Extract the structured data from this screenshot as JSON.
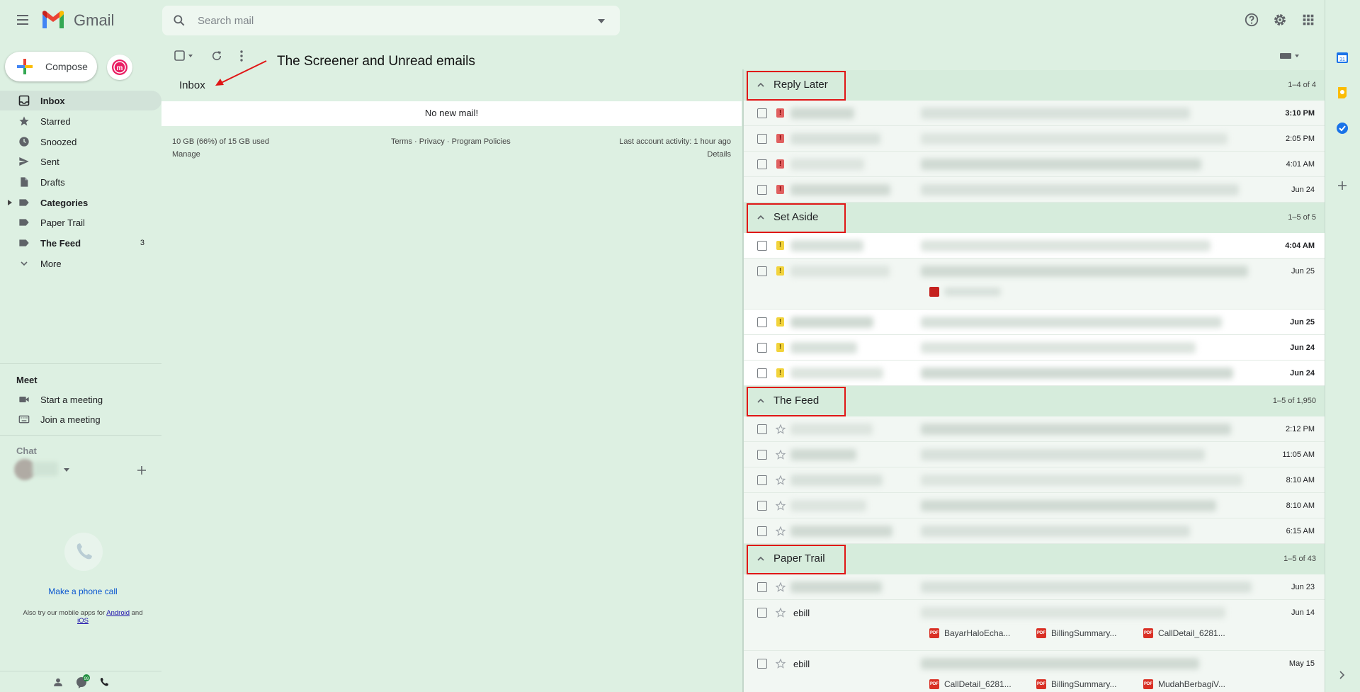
{
  "header": {
    "brand": "Gmail",
    "search_placeholder": "Search mail"
  },
  "sidebar": {
    "compose_label": "Compose",
    "items": [
      {
        "label": "Inbox",
        "icon": "inbox-icon",
        "active": true
      },
      {
        "label": "Starred",
        "icon": "star-icon"
      },
      {
        "label": "Snoozed",
        "icon": "clock-icon"
      },
      {
        "label": "Sent",
        "icon": "send-icon"
      },
      {
        "label": "Drafts",
        "icon": "draft-icon"
      },
      {
        "label": "Categories",
        "icon": "label-icon"
      },
      {
        "label": "Paper Trail",
        "icon": "label-icon"
      },
      {
        "label": "The Feed",
        "icon": "label-icon",
        "count": "3"
      },
      {
        "label": "More",
        "icon": "chevron-down-icon"
      }
    ],
    "meet": {
      "title": "Meet",
      "start": "Start a meeting",
      "join": "Join a meeting"
    },
    "chat": {
      "title": "Chat",
      "make_call": "Make a phone call",
      "also_try_prefix": "Also try our mobile apps for",
      "android": "Android",
      "and": "and",
      "ios": "iOS"
    }
  },
  "inbox": {
    "annotation": "The Screener and Unread emails",
    "title": "Inbox",
    "empty_message": "No new mail!",
    "storage": "10 GB (66%) of 15 GB used",
    "manage": "Manage",
    "terms": "Terms",
    "privacy": "Privacy",
    "program_policies": "Program Policies",
    "dot": "·",
    "last_activity": "Last account activity: 1 hour ago",
    "details": "Details"
  },
  "sections": [
    {
      "title": "Reply Later",
      "range": "1–4 of 4",
      "marker": "red",
      "rows": [
        {
          "date": "3:10 PM",
          "bold": true
        },
        {
          "date": "2:05 PM"
        },
        {
          "date": "4:01 AM"
        },
        {
          "date": "Jun 24"
        }
      ]
    },
    {
      "title": "Set Aside",
      "range": "1–5 of 5",
      "marker": "yellow",
      "rows": [
        {
          "date": "4:04 AM",
          "bold": true,
          "white": true
        },
        {
          "date": "Jun 25"
        },
        {
          "date": "Jun 25",
          "bold": true,
          "white": true
        },
        {
          "date": "Jun 24",
          "bold": true,
          "white": true
        },
        {
          "date": "Jun 24",
          "bold": true,
          "white": true
        }
      ]
    },
    {
      "title": "The Feed",
      "range": "1–5 of 1,950",
      "marker": "star",
      "rows": [
        {
          "date": "2:12 PM"
        },
        {
          "date": "11:05 AM"
        },
        {
          "date": "8:10 AM"
        },
        {
          "date": "8:10 AM"
        },
        {
          "date": "6:15 AM"
        }
      ]
    },
    {
      "title": "Paper Trail",
      "range": "1–5 of 43",
      "marker": "star",
      "rows": [
        {
          "date": "Jun 23"
        },
        {
          "date": "Jun 14",
          "sender": "ebill",
          "attachments": [
            "BayarHaloEcha...",
            "BillingSummary...",
            "CallDetail_6281..."
          ]
        },
        {
          "date": "May 15",
          "sender": "ebill",
          "attachments": [
            "CallDetail_6281...",
            "BillingSummary...",
            "MudahBerbagiV..."
          ]
        }
      ]
    }
  ],
  "colors": {
    "background": "#ddf0e2",
    "highlight_box": "#e01616",
    "link": "#0b57d0"
  }
}
